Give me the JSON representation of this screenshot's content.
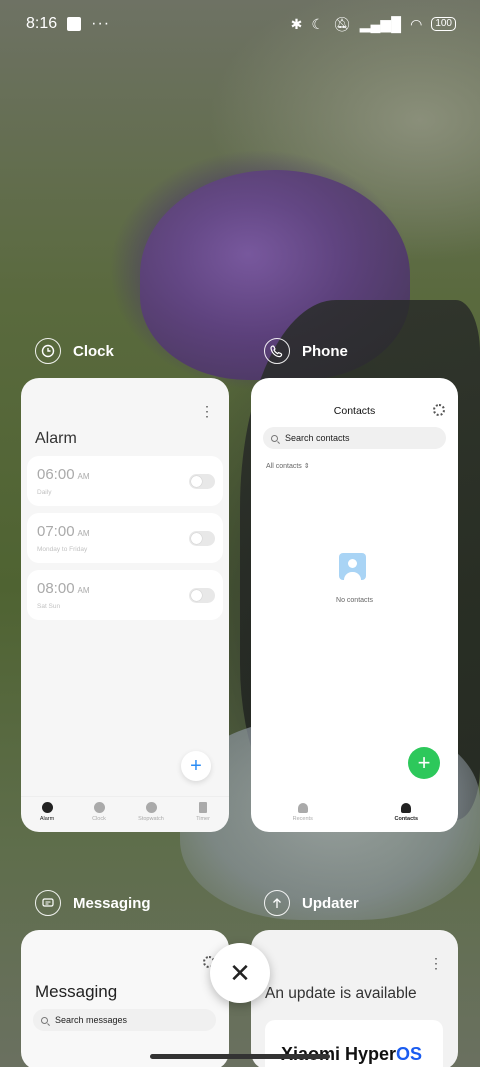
{
  "status_bar": {
    "time": "8:16",
    "more": "···",
    "battery": "100"
  },
  "apps": {
    "clock": {
      "label": "Clock",
      "title": "Alarm",
      "alarms": [
        {
          "time": "06:00",
          "ampm": "AM",
          "repeat": "Daily",
          "enabled": false
        },
        {
          "time": "07:00",
          "ampm": "AM",
          "repeat": "Monday to Friday",
          "enabled": false
        },
        {
          "time": "08:00",
          "ampm": "AM",
          "repeat": "Sat Sun",
          "enabled": false
        }
      ],
      "add": "+",
      "tabs": [
        "Alarm",
        "Clock",
        "Stopwatch",
        "Timer"
      ]
    },
    "phone": {
      "label": "Phone",
      "title": "Contacts",
      "search_placeholder": "Search contacts",
      "filter": "All contacts",
      "filter_caret": "⇕",
      "empty": "No contacts",
      "add": "+",
      "tabs": [
        "Recents",
        "Contacts"
      ]
    },
    "messaging": {
      "label": "Messaging",
      "title": "Messaging",
      "search_placeholder": "Search messages"
    },
    "updater": {
      "label": "Updater",
      "title": "An update is available",
      "brand": "Xiaomi Hyper",
      "brand_os": "OS"
    }
  },
  "close": "✕",
  "colors": {
    "phone_fab": "#2dc85b",
    "clock_fab": "#2a8cf5",
    "hyperos": "#1a5cf0"
  }
}
